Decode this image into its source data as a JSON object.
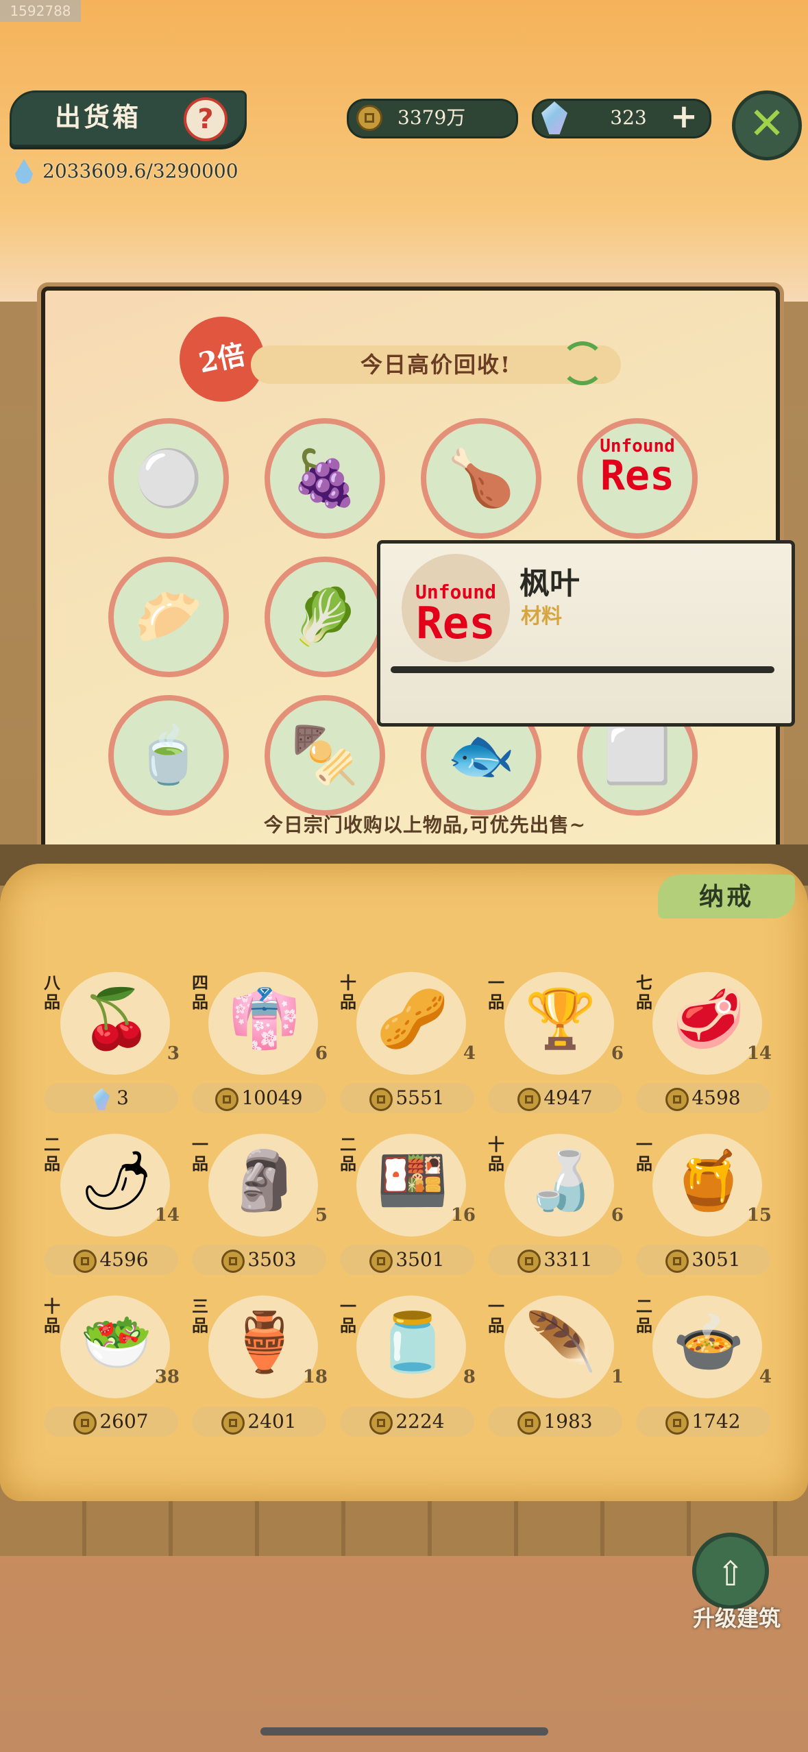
{
  "build_id": "1592788",
  "header": {
    "title": "出货箱",
    "help": "?",
    "coins": "3379万",
    "gems": "323",
    "plus": "+",
    "close": "✕",
    "water": "2033609.6/3290000"
  },
  "board": {
    "multiplier": "2倍",
    "banner": "今日高价回收!",
    "footer": "今日宗门收购以上物品,可优先出售~",
    "items": [
      {
        "icon": "rice-grains-icon",
        "glyph": "⚪"
      },
      {
        "icon": "grape-icon",
        "glyph": "🍇"
      },
      {
        "icon": "roasted-meat-icon",
        "glyph": "🍗"
      },
      {
        "icon": "unfound-res-icon",
        "glyph": ""
      },
      {
        "icon": "dumpling-plate-icon",
        "glyph": "🥟"
      },
      {
        "icon": "vegetable-plate-icon",
        "glyph": "🥬"
      },
      {
        "icon": "hidden-item-icon",
        "glyph": ""
      },
      {
        "icon": "hidden-item-icon",
        "glyph": ""
      },
      {
        "icon": "tea-cup-icon",
        "glyph": "🍵"
      },
      {
        "icon": "grilled-skewer-icon",
        "glyph": "🍢"
      },
      {
        "icon": "fish-fillet-icon",
        "glyph": "🐟"
      },
      {
        "icon": "tofu-icon",
        "glyph": "⬜"
      }
    ]
  },
  "tooltip": {
    "unfound_top": "Unfound",
    "unfound_bottom": "Res",
    "name": "枫叶",
    "type": "材料"
  },
  "inventory": {
    "tab": "纳戒",
    "items": [
      {
        "grade": "八品",
        "glyph": "🍒",
        "qty": "3",
        "price": "3",
        "currency": "gem",
        "icon": "red-berries-icon"
      },
      {
        "grade": "四品",
        "glyph": "👘",
        "qty": "6",
        "price": "10049",
        "currency": "coin",
        "icon": "robe-icon"
      },
      {
        "grade": "十品",
        "glyph": "🥜",
        "qty": "4",
        "price": "5551",
        "currency": "coin",
        "icon": "nuts-leaf-icon"
      },
      {
        "grade": "一品",
        "glyph": "🏆",
        "qty": "6",
        "price": "4947",
        "currency": "coin",
        "icon": "jade-treasure-icon"
      },
      {
        "grade": "七品",
        "glyph": "🥩",
        "qty": "14",
        "price": "4598",
        "currency": "coin",
        "icon": "dried-meat-icon"
      },
      {
        "grade": "二品",
        "glyph": "🌶",
        "qty": "14",
        "price": "4596",
        "currency": "coin",
        "icon": "chili-dish-icon"
      },
      {
        "grade": "一品",
        "glyph": "🗿",
        "qty": "5",
        "price": "3503",
        "currency": "coin",
        "icon": "statue-icon"
      },
      {
        "grade": "二品",
        "glyph": "🍱",
        "qty": "16",
        "price": "3501",
        "currency": "coin",
        "icon": "food-box-icon"
      },
      {
        "grade": "十品",
        "glyph": "🍶",
        "qty": "6",
        "price": "3311",
        "currency": "coin",
        "icon": "gourd-icon"
      },
      {
        "grade": "一品",
        "glyph": "🍯",
        "qty": "15",
        "price": "3051",
        "currency": "coin",
        "icon": "clay-pot-icon"
      },
      {
        "grade": "十品",
        "glyph": "🥗",
        "qty": "38",
        "price": "2607",
        "currency": "coin",
        "icon": "herb-plate-icon"
      },
      {
        "grade": "三品",
        "glyph": "🏺",
        "qty": "18",
        "price": "2401",
        "currency": "coin",
        "icon": "vase-icon"
      },
      {
        "grade": "一品",
        "glyph": "🫙",
        "qty": "8",
        "price": "2224",
        "currency": "coin",
        "icon": "wine-jar-icon"
      },
      {
        "grade": "一品",
        "glyph": "🪶",
        "qty": "1",
        "price": "1983",
        "currency": "coin",
        "icon": "feather-icon"
      },
      {
        "grade": "二品",
        "glyph": "🍲",
        "qty": "4",
        "price": "1742",
        "currency": "coin",
        "icon": "soup-pot-icon"
      }
    ]
  },
  "upgrade": {
    "label": "升级建筑",
    "glyph": "⇧"
  }
}
